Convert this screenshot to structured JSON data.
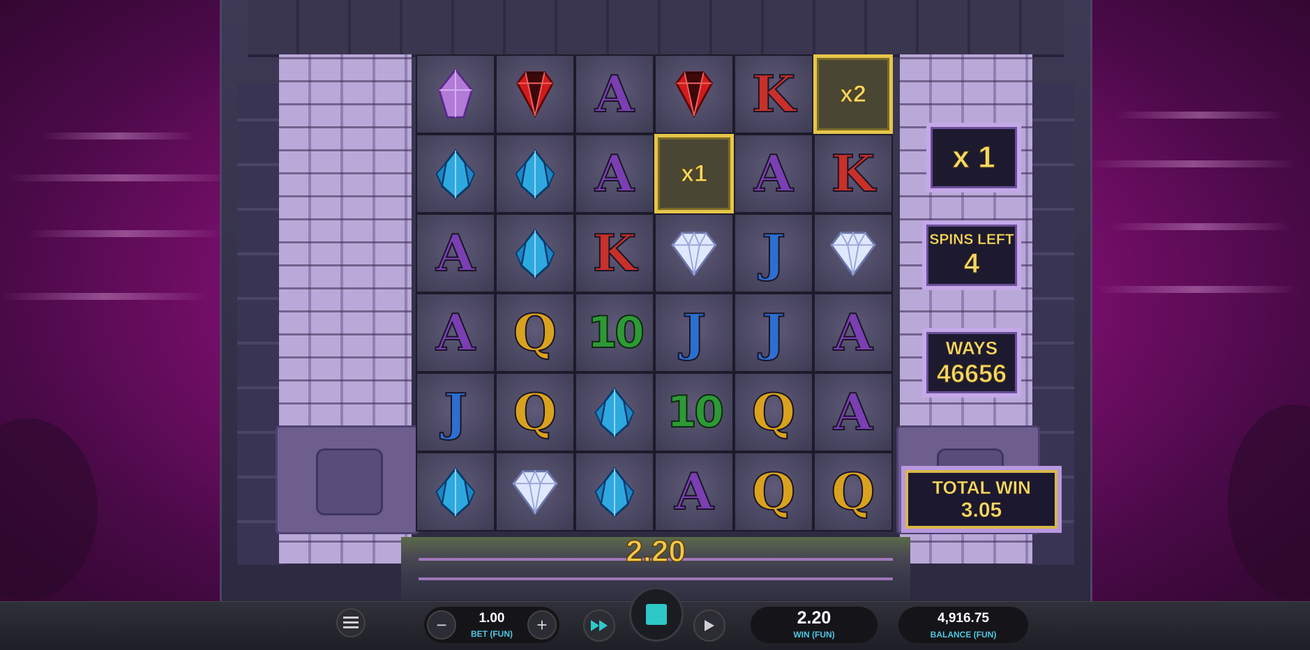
{
  "grid": [
    [
      "purple-crystal-icon",
      "red-ruby-icon",
      "A",
      "red-ruby-icon",
      "K",
      "x2"
    ],
    [
      "blue-crystal-icon",
      "blue-crystal-icon",
      "A",
      "x1",
      "A",
      "K"
    ],
    [
      "A",
      "blue-crystal-icon",
      "K",
      "diamond-icon",
      "J",
      "diamond-icon"
    ],
    [
      "A",
      "Q",
      "10",
      "J",
      "J",
      "A"
    ],
    [
      "J",
      "Q",
      "blue-crystal-icon",
      "10",
      "Q",
      "A"
    ],
    [
      "blue-crystal-icon",
      "diamond-icon",
      "blue-crystal-icon",
      "A",
      "Q",
      "Q"
    ]
  ],
  "symbol_colors": {
    "A": "#7a3fb2",
    "K": "#c8302a",
    "Q": "#d9a21e",
    "J": "#2c6fd1",
    "10": "#2d9a35"
  },
  "panels": {
    "multiplier": "x 1",
    "spins_left_label": "SPINS LEFT",
    "spins_left_value": "4",
    "ways_label": "WAYS",
    "ways_value": "46656",
    "total_win_label": "TOTAL WIN",
    "total_win_value": "3.05"
  },
  "line_win": "2.20",
  "bottom_bar": {
    "menu_icon": "hamburger-icon",
    "bet_value": "1.00",
    "bet_label": "BET (FUN)",
    "minus": "−",
    "plus": "+",
    "turbo_icon": "fast-forward-icon",
    "autoplay_icon": "play-icon",
    "win_value": "2.20",
    "win_label": "WIN (FUN)",
    "balance_value": "4,916.75",
    "balance_label": "BALANCE (FUN)"
  },
  "accent_color": "#2ec8c8"
}
